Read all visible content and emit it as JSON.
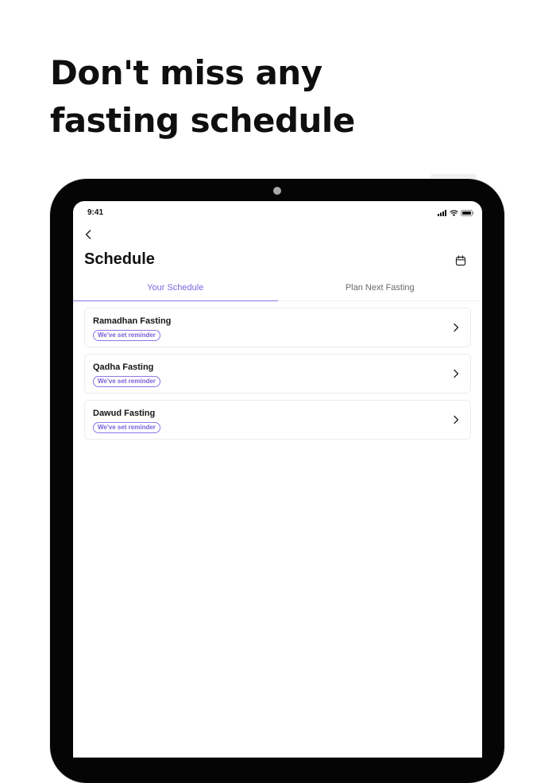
{
  "headline": {
    "line1": "Don't miss any",
    "line2": "fasting schedule"
  },
  "status_bar": {
    "time": "9:41",
    "icons": [
      "signal-icon",
      "wifi-icon",
      "battery-icon"
    ]
  },
  "header": {
    "back_icon": "chevron-left-icon",
    "title": "Schedule",
    "calendar_icon": "calendar-icon"
  },
  "tabs": [
    {
      "label": "Your Schedule",
      "active": true
    },
    {
      "label": "Plan Next Fasting",
      "active": false
    }
  ],
  "schedules": [
    {
      "title": "Ramadhan Fasting",
      "badge": "We've set reminder"
    },
    {
      "title": "Qadha Fasting",
      "badge": "We've set reminder"
    },
    {
      "title": "Dawud Fasting",
      "badge": "We've set reminder"
    }
  ],
  "colors": {
    "accent": "#8065e0",
    "device_frame": "#050505",
    "text": "#151515"
  }
}
